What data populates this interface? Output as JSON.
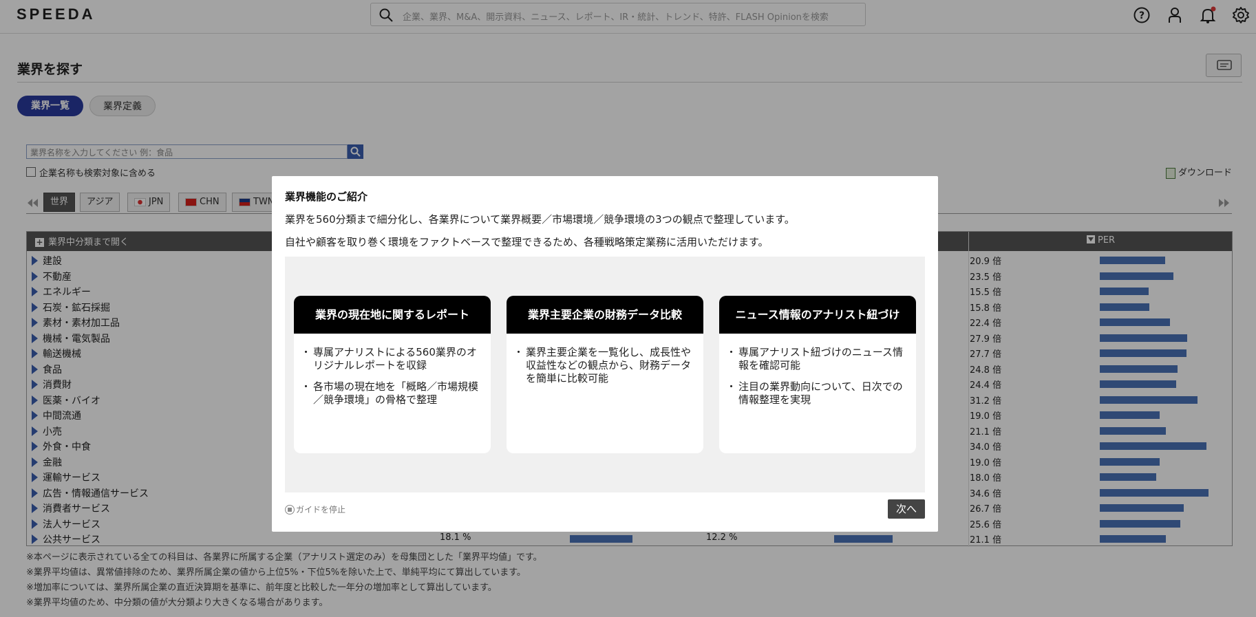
{
  "header": {
    "logo": "SPEEDA",
    "search_placeholder": "企業、業界、M&A、開示資料、ニュース、レポート、IR・統計、トレンド、特許、FLASH Opinionを検索"
  },
  "page": {
    "title": "業界を探す",
    "pill_list": "業界一覧",
    "pill_definition": "業界定義",
    "search_placeholder": "業界名称を入力してください 例：食品",
    "checkbox_label": "企業名称も検索対象に含める",
    "download_label": "ダウンロード"
  },
  "region_tabs": [
    "世界",
    "アジア",
    "JPN",
    "CHN",
    "TWN"
  ],
  "table": {
    "expand_label": "業界中分類まで開く",
    "per_header": "PER",
    "rows": [
      {
        "name": "建設",
        "per": "20.9 倍",
        "per_value": 20.9
      },
      {
        "name": "不動産",
        "per": "23.5 倍",
        "per_value": 23.5
      },
      {
        "name": "エネルギー",
        "per": "15.5 倍",
        "per_value": 15.5
      },
      {
        "name": "石炭・鉱石採掘",
        "per": "15.8 倍",
        "per_value": 15.8
      },
      {
        "name": "素材・素材加工品",
        "per": "22.4 倍",
        "per_value": 22.4
      },
      {
        "name": "機械・電気製品",
        "per": "27.9 倍",
        "per_value": 27.9
      },
      {
        "name": "輸送機械",
        "per": "27.7 倍",
        "per_value": 27.7
      },
      {
        "name": "食品",
        "per": "24.8 倍",
        "per_value": 24.8
      },
      {
        "name": "消費財",
        "per": "24.4 倍",
        "per_value": 24.4
      },
      {
        "name": "医薬・バイオ",
        "per": "31.2 倍",
        "per_value": 31.2
      },
      {
        "name": "中間流通",
        "per": "19.0 倍",
        "per_value": 19.0
      },
      {
        "name": "小売",
        "per": "21.1 倍",
        "per_value": 21.1
      },
      {
        "name": "外食・中食",
        "per": "34.0 倍",
        "per_value": 34.0
      },
      {
        "name": "金融",
        "per": "19.0 倍",
        "per_value": 19.0
      },
      {
        "name": "運輸サービス",
        "per": "18.0 倍",
        "per_value": 18.0
      },
      {
        "name": "広告・情報通信サービス",
        "per": "34.6 倍",
        "per_value": 34.6
      },
      {
        "name": "消費者サービス",
        "per": "26.7 倍",
        "per_value": 26.7
      },
      {
        "name": "法人サービス",
        "per": "25.6 倍",
        "per_value": 25.6
      },
      {
        "name": "公共サービス",
        "per": "21.1 倍",
        "per_value": 21.1,
        "col1": "18.1 %",
        "col2": "12.2 %"
      }
    ]
  },
  "notes": [
    "※本ページに表示されている全ての科目は、各業界に所属する企業（アナリスト選定のみ）を母集団とした「業界平均値」です。",
    "※業界平均値は、異常値排除のため、業界所属企業の値から上位5%・下位5%を除いた上で、単純平均にて算出しています。",
    "※増加率については、業界所属企業の直近決算期を基準に、前年度と比較した一年分の増加率として算出しています。",
    "※業界平均値のため、中分類の値が大分類より大きくなる場合があります。"
  ],
  "modal": {
    "title": "業界機能のご紹介",
    "desc1": "業界を560分類まで細分化し、各業界について業界概要／市場環境／競争環境の3つの観点で整理しています。",
    "desc2": "自社や顧客を取り巻く環境をファクトベースで整理できるため、各種戦略策定業務に活用いただけます。",
    "cards": [
      {
        "title": "業界の現在地に関するレポート",
        "bullets": [
          "専属アナリストによる560業界のオリジナルレポートを収録",
          "各市場の現在地を「概略／市場規模／競争環境」の骨格で整理"
        ]
      },
      {
        "title": "業界主要企業の財務データ比較",
        "bullets": [
          "業界主要企業を一覧化し、成長性や収益性などの観点から、財務データを簡単に比較可能"
        ]
      },
      {
        "title": "ニュース情報のアナリスト紐づけ",
        "bullets": [
          "専属アナリスト紐づけのニュース情報を確認可能",
          "注目の業界動向について、日次での情報整理を実現"
        ]
      }
    ],
    "stop_label": "ガイドを停止",
    "next_label": "次へ"
  }
}
